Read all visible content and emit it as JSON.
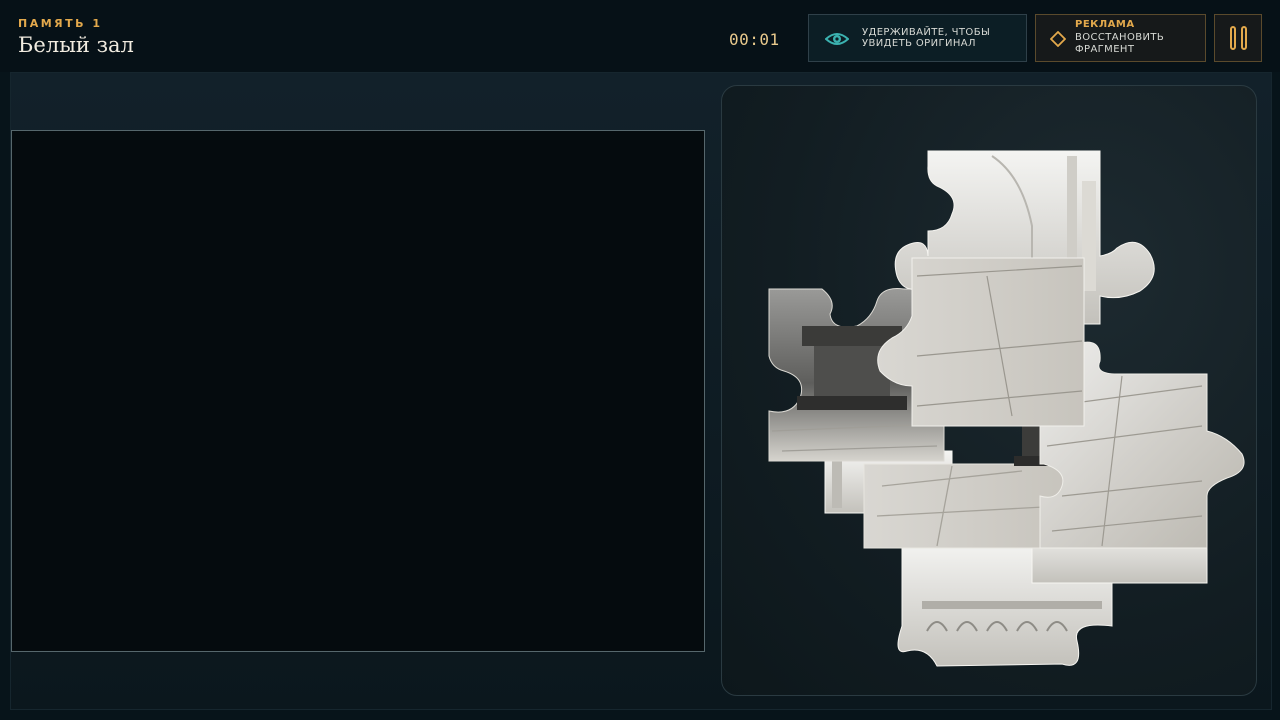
{
  "header": {
    "subtitle": "ПАМЯТЬ 1",
    "title": "Белый зал",
    "timer": "00:01"
  },
  "buttons": {
    "peek_label": "УДЕРЖИВАЙТЕ, ЧТОБЫ УВИДЕТЬ ОРИГИНАЛ",
    "peek_icon": "eye-icon",
    "ad_tag": "РЕКЛАМА",
    "ad_label": "ВОССТАНОВИТЬ ФРАГМЕНТ",
    "ad_icon": "diamond-icon",
    "pause_icon": "pause-icon"
  },
  "colors": {
    "accent": "#e3a94c",
    "background": "#07141a",
    "target_area": "#050b0e",
    "eye_icon": "#3bb2b0"
  },
  "puzzle": {
    "piece_icon": "jigsaw-piece"
  }
}
